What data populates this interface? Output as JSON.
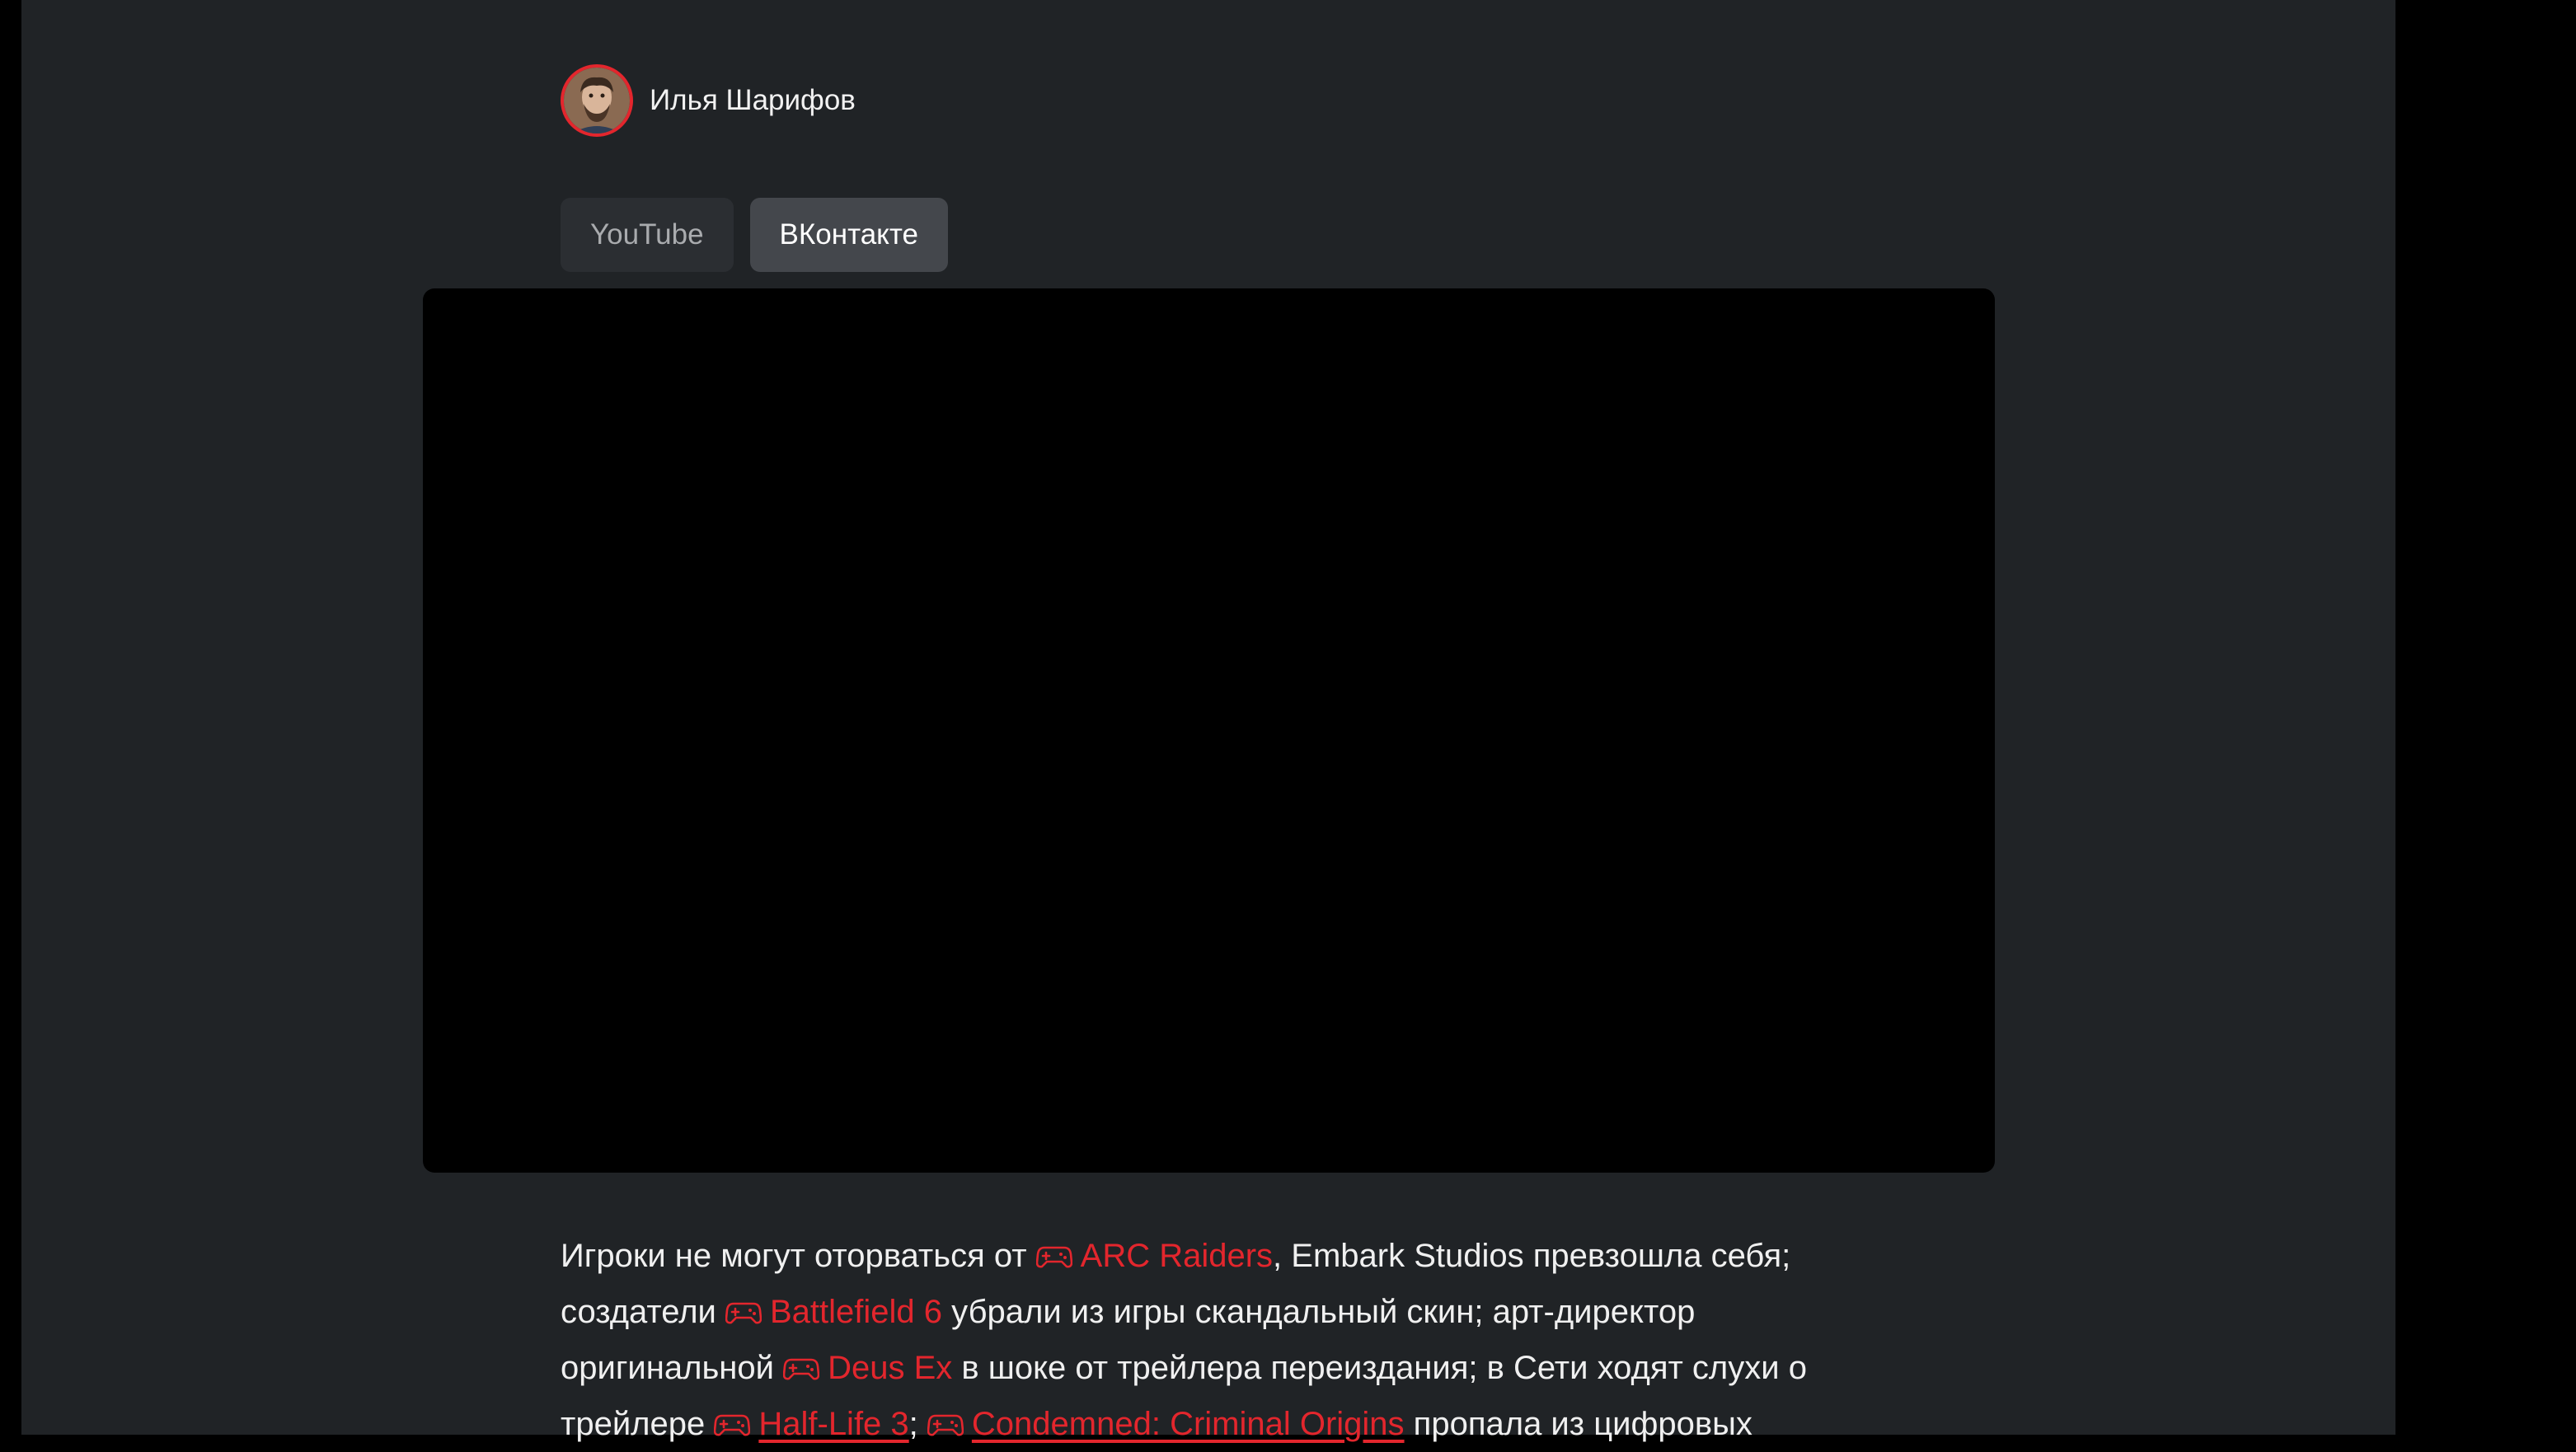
{
  "author": {
    "name": "Илья Шарифов"
  },
  "tabs": [
    {
      "label": "YouTube",
      "active": false
    },
    {
      "label": "ВКонтакте",
      "active": true
    }
  ],
  "colors": {
    "accent": "#e3262d",
    "page_bg": "#202326",
    "outer_bg": "#000000",
    "video_bg": "#000000"
  },
  "article": {
    "t1": "Игроки не могут оторваться от ",
    "l1": "ARC Raiders",
    "t2": ", Embark Studios превзошла себя; создатели ",
    "l2": "Battlefield 6",
    "t3": " убрали из игры скандальный скин; арт-директор оригинальной ",
    "l3": "Deus Ex",
    "t4": " в шоке от трейлера переиздания; в Сети ходят слухи о трейлере ",
    "l4": "Half-Life 3",
    "t5": "; ",
    "l5": "Condemned: Criminal Origins",
    "t6": " пропала из цифровых"
  }
}
